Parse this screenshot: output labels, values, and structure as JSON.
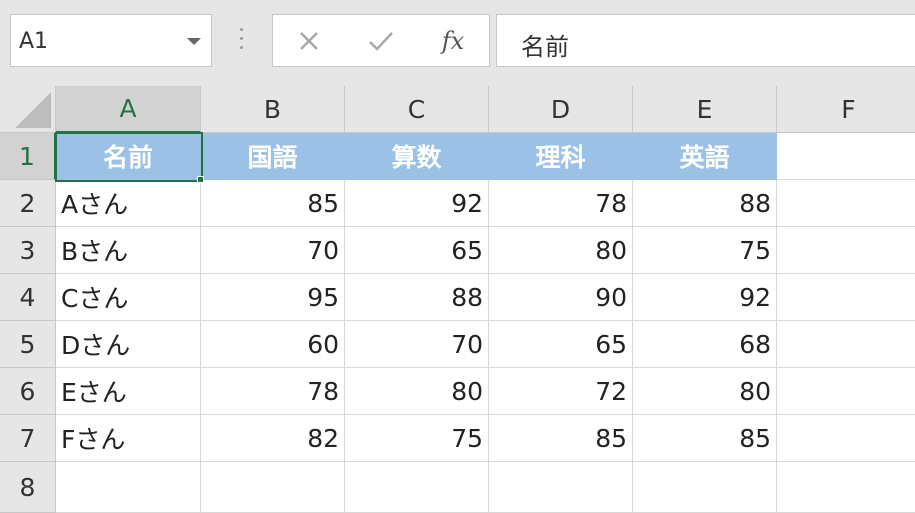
{
  "name_box": {
    "value": "A1"
  },
  "formula_bar": {
    "fx_label": "fx",
    "value": "名前"
  },
  "columns": [
    "A",
    "B",
    "C",
    "D",
    "E",
    "F"
  ],
  "rows": [
    "1",
    "2",
    "3",
    "4",
    "5",
    "6",
    "7",
    "8"
  ],
  "table": {
    "headers": [
      "名前",
      "国語",
      "算数",
      "理科",
      "英語"
    ],
    "records": [
      [
        "Aさん",
        "85",
        "92",
        "78",
        "88"
      ],
      [
        "Bさん",
        "70",
        "65",
        "80",
        "75"
      ],
      [
        "Cさん",
        "95",
        "88",
        "90",
        "92"
      ],
      [
        "Dさん",
        "60",
        "70",
        "65",
        "68"
      ],
      [
        "Eさん",
        "78",
        "80",
        "72",
        "80"
      ],
      [
        "Fさん",
        "82",
        "75",
        "85",
        "85"
      ]
    ]
  },
  "colors": {
    "header_fill": "#9bc2e6",
    "selection": "#217346"
  },
  "icons": {
    "cancel": "close-icon",
    "enter": "check-icon",
    "function": "fx-icon"
  }
}
